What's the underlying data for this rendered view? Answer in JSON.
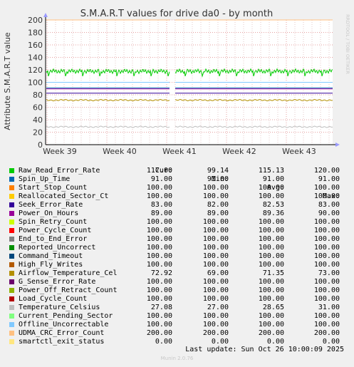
{
  "chart_data": {
    "type": "line",
    "title": "S.M.A.R.T values for drive da0 - by month",
    "ylabel": "Attribute S.M.A.R.T value",
    "watermark": "RRDTOOL / TOBI OETIKER",
    "ylim": [
      0,
      200
    ],
    "yticks": [
      0,
      20,
      40,
      60,
      80,
      100,
      120,
      140,
      160,
      180,
      200
    ],
    "xticks": [
      "Week 39",
      "Week 40",
      "Week 41",
      "Week 42",
      "Week 43"
    ],
    "gap_after_week": 41,
    "series": [
      {
        "name": "Raw_Read_Error_Rate",
        "color": "#00cc00",
        "cur": "117.00",
        "min": "99.14",
        "avg": "115.13",
        "max": "120.00",
        "base": 115,
        "pattern": "saw",
        "amp": 4
      },
      {
        "name": "Spin_Up_Time",
        "color": "#0066b3",
        "cur": "91.00",
        "min": "91.00",
        "avg": "91.00",
        "max": "91.00",
        "base": 91
      },
      {
        "name": "Start_Stop_Count",
        "color": "#ff8000",
        "cur": "100.00",
        "min": "100.00",
        "avg": "100.00",
        "max": "100.00",
        "base": 100
      },
      {
        "name": "Reallocated_Sector_Ct",
        "color": "#ffcc00",
        "cur": "100.00",
        "min": "100.00",
        "avg": "100.00",
        "max": "100.00",
        "base": 100
      },
      {
        "name": "Seek_Error_Rate",
        "color": "#330099",
        "cur": "83.00",
        "min": "82.00",
        "avg": "82.53",
        "max": "83.00",
        "base": 82.5
      },
      {
        "name": "Power_On_Hours",
        "color": "#990099",
        "cur": "89.00",
        "min": "89.00",
        "avg": "89.36",
        "max": "90.00",
        "base": 89.4
      },
      {
        "name": "Spin_Retry_Count",
        "color": "#ccff00",
        "cur": "100.00",
        "min": "100.00",
        "avg": "100.00",
        "max": "100.00",
        "base": 100
      },
      {
        "name": "Power_Cycle_Count",
        "color": "#ff0000",
        "cur": "100.00",
        "min": "100.00",
        "avg": "100.00",
        "max": "100.00",
        "base": 100
      },
      {
        "name": "End_to_End_Error",
        "color": "#808080",
        "cur": "100.00",
        "min": "100.00",
        "avg": "100.00",
        "max": "100.00",
        "base": 100
      },
      {
        "name": "Reported_Uncorrect",
        "color": "#008f00",
        "cur": "100.00",
        "min": "100.00",
        "avg": "100.00",
        "max": "100.00",
        "base": 100
      },
      {
        "name": "Command_Timeout",
        "color": "#00487d",
        "cur": "100.00",
        "min": "100.00",
        "avg": "100.00",
        "max": "100.00",
        "base": 100
      },
      {
        "name": "High_Fly_Writes",
        "color": "#b35a00",
        "cur": "100.00",
        "min": "100.00",
        "avg": "100.00",
        "max": "100.00",
        "base": 100
      },
      {
        "name": "Airflow_Temperature_Cel",
        "color": "#b38f00",
        "cur": "72.92",
        "min": "69.00",
        "avg": "71.35",
        "max": "73.00",
        "base": 71.4,
        "pattern": "wiggle",
        "amp": 1.2
      },
      {
        "name": "G_Sense_Error_Rate",
        "color": "#6b006b",
        "cur": "100.00",
        "min": "100.00",
        "avg": "100.00",
        "max": "100.00",
        "base": 100
      },
      {
        "name": "Power_Off_Retract_Count",
        "color": "#8fb300",
        "cur": "100.00",
        "min": "100.00",
        "avg": "100.00",
        "max": "100.00",
        "base": 100
      },
      {
        "name": "Load_Cycle_Count",
        "color": "#b30000",
        "cur": "100.00",
        "min": "100.00",
        "avg": "100.00",
        "max": "100.00",
        "base": 100
      },
      {
        "name": "Temperature_Celsius",
        "color": "#bebebe",
        "cur": "27.08",
        "min": "27.00",
        "avg": "28.65",
        "max": "31.00",
        "base": 28.6,
        "pattern": "wiggle",
        "amp": 1.2
      },
      {
        "name": "Current_Pending_Sector",
        "color": "#80ff80",
        "cur": "100.00",
        "min": "100.00",
        "avg": "100.00",
        "max": "100.00",
        "base": 100
      },
      {
        "name": "Offline_Uncorrectable",
        "color": "#80c9ff",
        "cur": "100.00",
        "min": "100.00",
        "avg": "100.00",
        "max": "100.00",
        "base": 100
      },
      {
        "name": "UDMA_CRC_Error_Count",
        "color": "#ffc080",
        "cur": "200.00",
        "min": "200.00",
        "avg": "200.00",
        "max": "200.00",
        "base": 200
      },
      {
        "name": "smartctl_exit_status",
        "color": "#ffe680",
        "cur": "0.00",
        "min": "0.00",
        "avg": "0.00",
        "max": "0.00",
        "base": 0
      }
    ]
  },
  "legend": {
    "cur": "Cur:",
    "min": "Min:",
    "avg": "Avg:",
    "max": "Max:"
  },
  "footer": {
    "last_update": "Last update: Sun Oct 26 10:00:09 2025",
    "munin": "Munin 2.0.76"
  }
}
